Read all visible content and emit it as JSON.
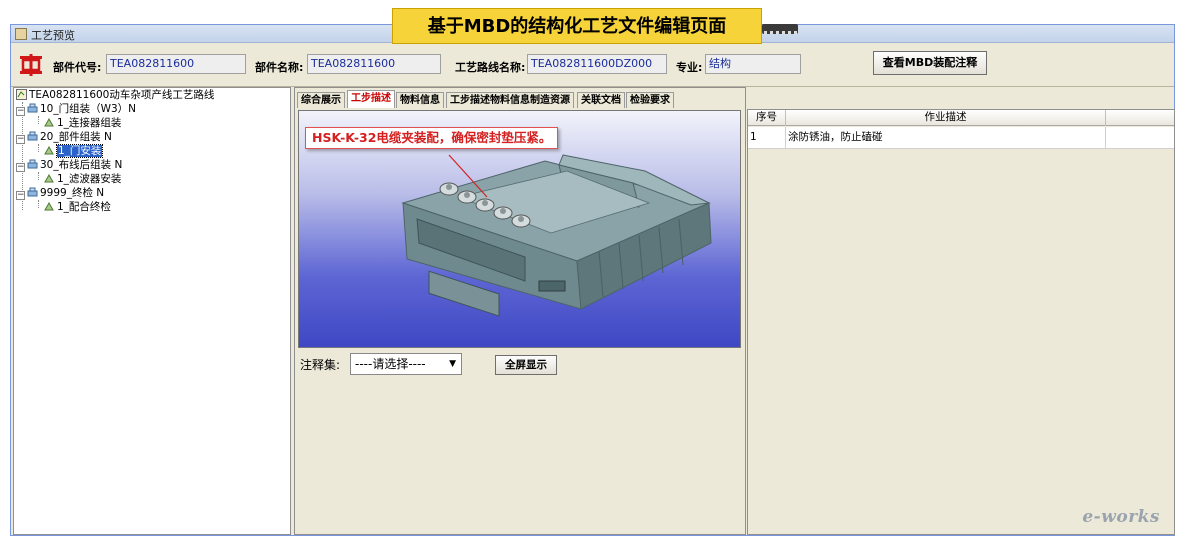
{
  "banner": {
    "title": "基于MBD的结构化工艺文件编辑页面"
  },
  "window": {
    "title": "工艺预览"
  },
  "header": {
    "part_code_label": "部件代号:",
    "part_code_value": "TEA082811600",
    "part_name_label": "部件名称:",
    "part_name_value": "TEA082811600",
    "route_name_label": "工艺路线名称:",
    "route_name_value": "TEA082811600DZ000",
    "specialty_label": "专业:",
    "specialty_value": "结构",
    "mbd_button": "查看MBD装配注释"
  },
  "tree": {
    "root": "TEA082811600动车杂项产线工艺路线",
    "nodes": [
      {
        "label": "10_门组装（W3）N",
        "children": [
          "1_连接器组装"
        ]
      },
      {
        "label": "20_部件组装 N",
        "children": [
          "1_门安装"
        ]
      },
      {
        "label": "30_布线后组装 N",
        "children": [
          "1_滤波器安装"
        ]
      },
      {
        "label": "9999_终检 N",
        "children": [
          "1_配合终检"
        ]
      }
    ],
    "selected": "1_门安装"
  },
  "tabs": [
    {
      "label": "综合展示",
      "active": false
    },
    {
      "label": "工步描述",
      "active": true
    },
    {
      "label": "物料信息",
      "active": false
    },
    {
      "label": "工步描述物料信息制造资源",
      "active": false
    },
    {
      "label": "关联文档",
      "active": false
    },
    {
      "label": "检验要求",
      "active": false
    }
  ],
  "viewport": {
    "callout": "HSK-K-32电缆夹装配，确保密封垫压紧。"
  },
  "annotation": {
    "label": "注释集:",
    "selected_option": "----请选择----",
    "fullscreen_button": "全屏显示"
  },
  "table": {
    "columns": [
      "序号",
      "作业描述"
    ],
    "rows": [
      {
        "index": "1",
        "description": "涂防锈油，防止磕碰"
      }
    ]
  },
  "watermark": "e-works",
  "colors": {
    "accent_tab": "#cc0000",
    "field_text": "#1a2d9a",
    "banner_bg": "#f7d33a",
    "selection": "#2a62c9"
  }
}
